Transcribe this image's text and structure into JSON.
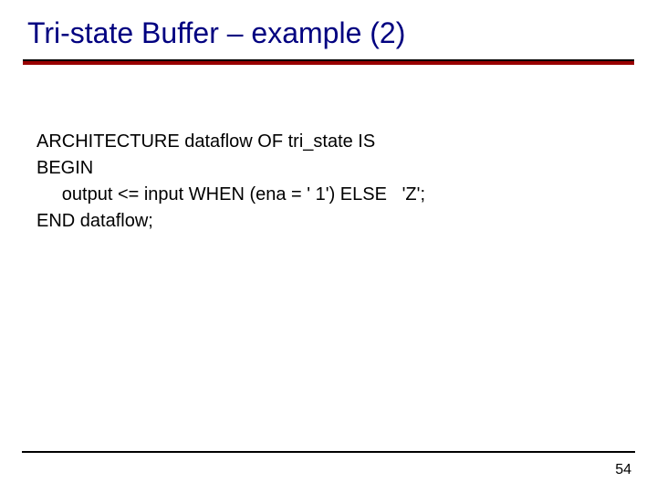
{
  "title": "Tri-state Buffer – example (2)",
  "code": {
    "line1": "ARCHITECTURE dataflow OF tri_state IS",
    "line2": "BEGIN",
    "line3": "     output <= input WHEN (ena = ' 1') ELSE   'Z';",
    "line4": "END dataflow;"
  },
  "page_number": "54"
}
